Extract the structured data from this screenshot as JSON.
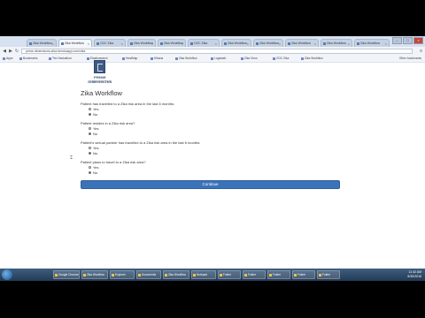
{
  "browser": {
    "tabs": [
      {
        "label": "Zika Workflow",
        "active": false
      },
      {
        "label": "Zika Workflow",
        "active": true
      },
      {
        "label": "CDC Zika",
        "active": false
      },
      {
        "label": "Zika Workflow",
        "active": false
      },
      {
        "label": "Zika Workflow",
        "active": false
      },
      {
        "label": "CDC Zika",
        "active": false
      },
      {
        "label": "Zika Workflow",
        "active": false
      },
      {
        "label": "Zika Workflow",
        "active": false
      },
      {
        "label": "Zika Workflow",
        "active": false
      },
      {
        "label": "Zika Workflow",
        "active": false
      },
      {
        "label": "Zika Workflow",
        "active": false
      }
    ],
    "url": "prime-dimensions-zika.herokuapp.com/zika",
    "bookmarks": [
      "Apps",
      "Bookmarks",
      "Tim Hackathon",
      "Elasticsearch",
      "HeatMap",
      "Kibana",
      "Zika Workflow",
      "Logstash",
      "Zika Virus",
      "CDC Zika",
      "Zika Workflow"
    ],
    "other_bookmarks": "Other bookmarks"
  },
  "page": {
    "logo": {
      "name": "PRIME DIMENSIONS",
      "tagline": "DATA & ANALYTICS"
    },
    "title": "Zika Workflow",
    "questions": [
      {
        "text": "Patient has travelled to a Zika risk area in the last 6 months:",
        "options": [
          {
            "label": "Yes",
            "selected": false
          },
          {
            "label": "No",
            "selected": true
          }
        ]
      },
      {
        "text": "Patient resides in a Zika risk area?",
        "options": [
          {
            "label": "Yes",
            "selected": false
          },
          {
            "label": "No",
            "selected": true
          }
        ]
      },
      {
        "text": "Patient's sexual partner has travelled to a Zika risk area in the last 6 months:",
        "options": [
          {
            "label": "Yes",
            "selected": false
          },
          {
            "label": "No",
            "selected": true
          }
        ]
      },
      {
        "text": "Patient plans to travel to a Zika risk area?",
        "options": [
          {
            "label": "Yes",
            "selected": false
          },
          {
            "label": "No",
            "selected": true
          }
        ]
      }
    ],
    "continue_label": "Continue"
  },
  "taskbar": {
    "items": [
      "Google Chrome",
      "Zika Workflow",
      "Explorer",
      "Documents",
      "Zika Workflow",
      "Notepad",
      "Folder",
      "Folder",
      "Folder",
      "Folder",
      "Folder"
    ],
    "time": "11:42 AM",
    "date": "8/30/2016"
  },
  "colors": {
    "button": "#3b73b9",
    "taskbar": "#233a55"
  }
}
